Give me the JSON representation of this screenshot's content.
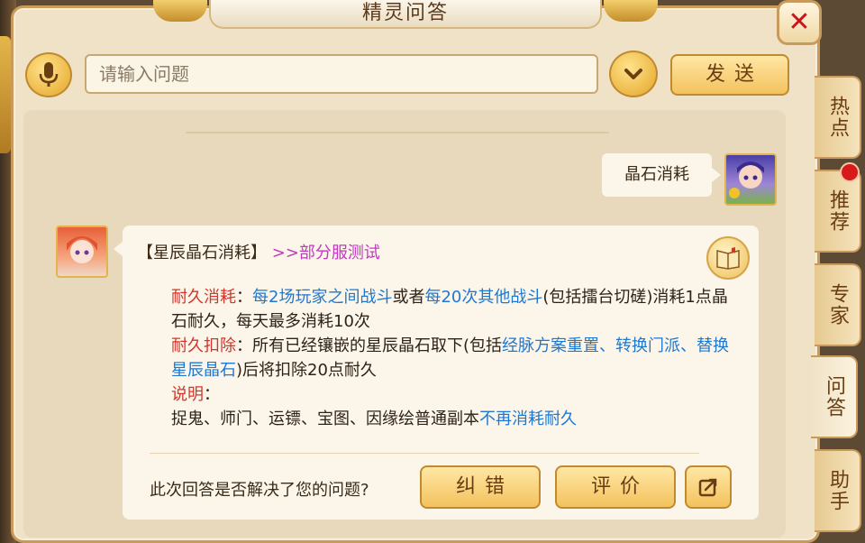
{
  "window": {
    "title": "精灵问答"
  },
  "search": {
    "placeholder": "请输入问题",
    "send_label": "发送"
  },
  "tabs": [
    {
      "label": "热点"
    },
    {
      "label": "推荐",
      "has_badge": true
    },
    {
      "label": "专家"
    },
    {
      "label": "问答",
      "active": true
    },
    {
      "label": "助手"
    }
  ],
  "chat": {
    "user_message": "晶石消耗",
    "answer": {
      "title": "【星辰晶石消耗】",
      "tag": ">>部分服测试",
      "item1_label": "耐久消耗",
      "item1_pre": "：",
      "item1_hl1": "每2场玩家之间战斗",
      "item1_mid": "或者",
      "item1_hl2": "每20次其他战斗",
      "item1_post": "(包括擂台切磋)消耗1点晶石耐久，每天最多消耗10次",
      "item2_label": "耐久扣除",
      "item2_pre": "：所有已经镶嵌的星辰晶石取下(包括",
      "item2_hl1": "经脉方案重置、转换门派、替换星辰晶石",
      "item2_post": ")后将扣除20点耐久",
      "item3_label": "说明",
      "item3_colon": "：",
      "item3_text": "捉鬼、师门、运镖、宝图、因缘绘普通副本",
      "item3_hl": "不再消耗耐久"
    },
    "feedback": {
      "question": "此次回答是否解决了您的问题?",
      "correct_label": "纠错",
      "rate_label": "评价"
    }
  },
  "colors": {
    "accent_gold": "#f3c25e",
    "highlight_blue": "#1d78d4",
    "label_red": "#d4342c",
    "tag_magenta": "#c437c4",
    "close_red": "#c8141c"
  },
  "icons": [
    "microphone-icon",
    "chevron-down-icon",
    "close-icon",
    "book-icon",
    "share-icon"
  ]
}
